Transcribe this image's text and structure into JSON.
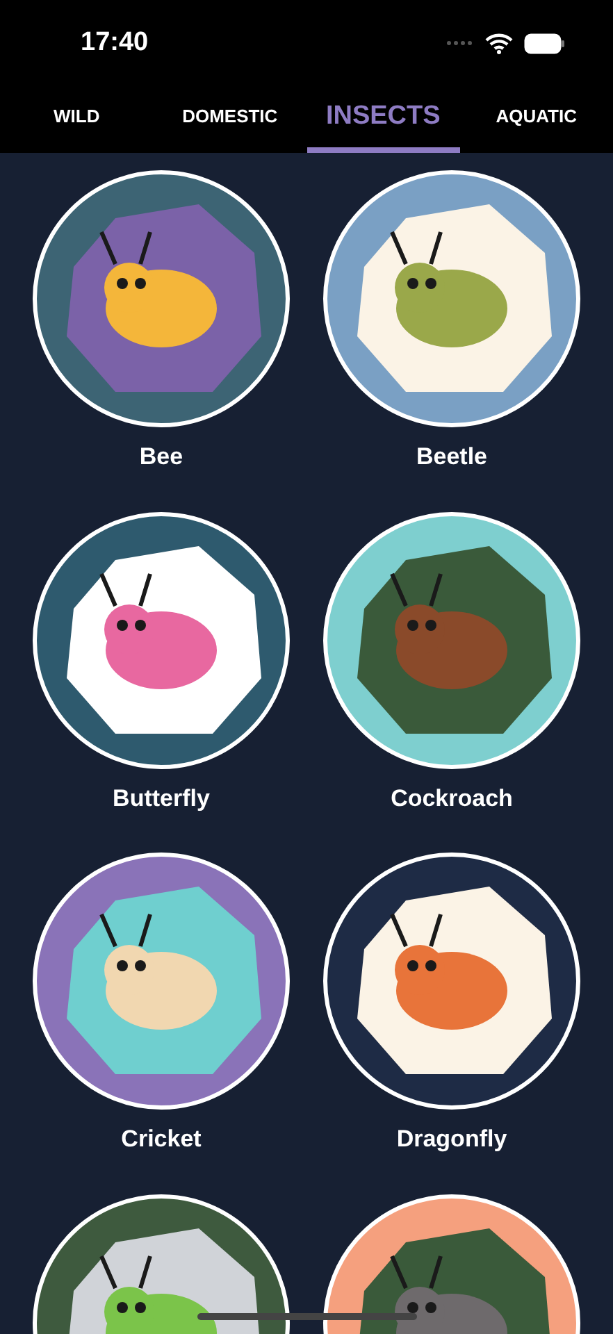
{
  "status_bar": {
    "time": "17:40"
  },
  "tabs": [
    {
      "label": "WILD",
      "selected": false
    },
    {
      "label": "DOMESTIC",
      "selected": false
    },
    {
      "label": "INSECTS",
      "selected": true
    },
    {
      "label": "AQUATIC",
      "selected": false
    }
  ],
  "animals": [
    {
      "name": "Bee",
      "color": "#3d6474"
    },
    {
      "name": "Beetle",
      "color": "#7aa0c4"
    },
    {
      "name": "Butterfly",
      "color": "#2e5a6e"
    },
    {
      "name": "Cockroach",
      "color": "#7ecfcf"
    },
    {
      "name": "Cricket",
      "color": "#8a73b8"
    },
    {
      "name": "Dragonfly",
      "color": "#1e2b45"
    },
    {
      "color": "#3e5a3e"
    },
    {
      "color": "#f5a07e"
    }
  ]
}
